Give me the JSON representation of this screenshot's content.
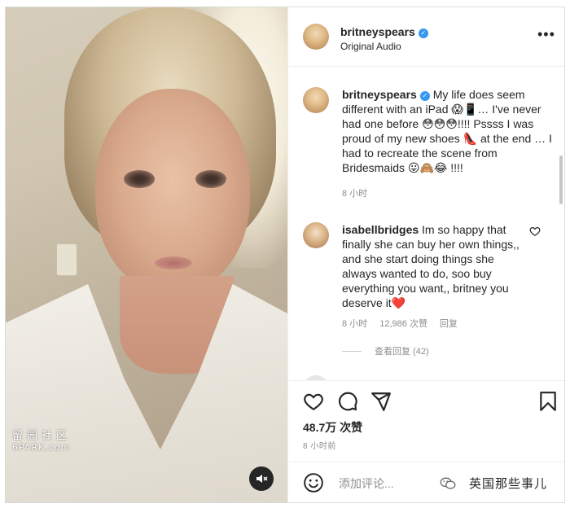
{
  "post": {
    "username": "britneyspears",
    "audio": "Original Audio",
    "more_label": "•••"
  },
  "caption": {
    "username": "britneyspears",
    "text": "My life does seem different with an iPad 😱📱… I've never had one before 😳😳😳!!!! Pssss I was proud of my new shoes 👠 at the end … I had to recreate the scene from Bridesmaids 😛🙈😂 !!!!",
    "time": "8 小时"
  },
  "comment": {
    "username": "isabellbridges",
    "text": "Im so happy that finally she can buy her own things,, and she start doing things she always wanted to do, soo buy everything you want,, britney you deserve it",
    "heart": "❤️",
    "time": "8 小时",
    "likes": "12,986 次赞",
    "reply": "回复",
    "view_replies": "查看回复 (42)"
  },
  "actions": {
    "likes": "48.7万 次赞",
    "posted": "8 小时前"
  },
  "add_comment": {
    "placeholder": "添加评论...",
    "brand": "英国那些事儿"
  },
  "watermark": {
    "line1": "留园社区",
    "line2": "6PARK.com"
  },
  "icons": {
    "verified": "verified-badge-icon",
    "like": "heart-icon",
    "comment": "comment-icon",
    "share": "share-icon",
    "save": "bookmark-icon",
    "mute": "muted-speaker-icon",
    "emoji": "emoji-icon"
  },
  "colors": {
    "verified_blue": "#3897f0",
    "text": "#262626",
    "secondary": "#8e8e8e",
    "heart_red": "#e0245e"
  }
}
